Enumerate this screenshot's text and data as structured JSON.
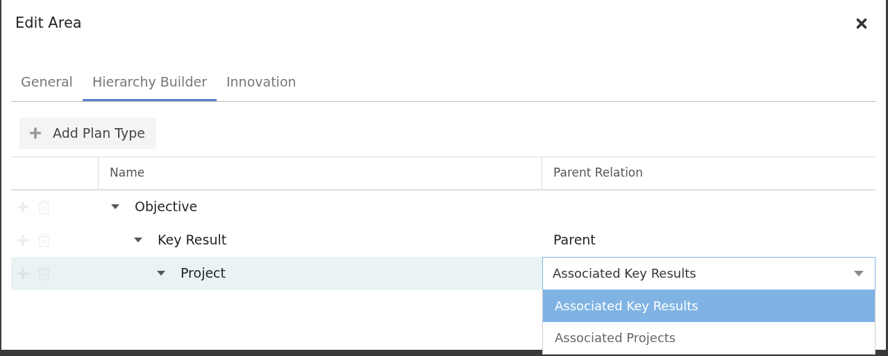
{
  "dialog": {
    "title": "Edit Area"
  },
  "tabs": [
    {
      "label": "General",
      "selected": false
    },
    {
      "label": "Hierarchy Builder",
      "selected": true
    },
    {
      "label": "Innovation",
      "selected": false
    }
  ],
  "toolbar": {
    "add_button": "Add Plan Type"
  },
  "table": {
    "columns": [
      "Name",
      "Parent Relation"
    ],
    "rows": [
      {
        "name": "Objective",
        "expanded": true,
        "selected": false,
        "children": [
          {
            "name": "Key Result",
            "expanded": true,
            "selected": false,
            "relation": {
              "kind": "text",
              "value": "Parent"
            },
            "children": [
              {
                "name": "Project",
                "expanded": true,
                "selected": true,
                "relation": {
                  "kind": "select",
                  "value": "Associated Key Results",
                  "expanded": true,
                  "options": [
                    {
                      "label": "Associated Key Results",
                      "selected": true
                    },
                    {
                      "label": "Associated Projects",
                      "selected": false
                    }
                  ]
                }
              }
            ]
          }
        ]
      }
    ]
  }
}
